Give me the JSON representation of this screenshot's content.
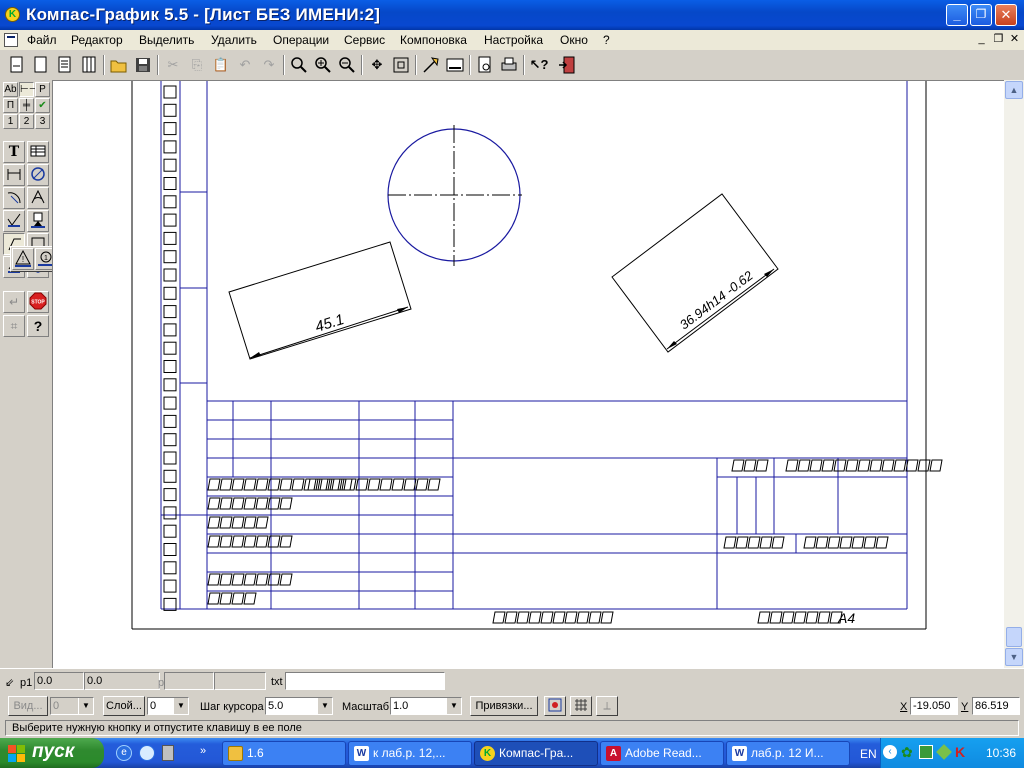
{
  "window": {
    "title": "Компас-График 5.5 - [Лист БЕЗ ИМЕНИ:2]",
    "minimize": "_",
    "maximize": "❐",
    "close": "✕"
  },
  "menu": {
    "items": [
      "Файл",
      "Редактор",
      "Выделить",
      "Удалить",
      "Операции",
      "Сервис",
      "Компоновка",
      "Настройка",
      "Окно",
      "?"
    ]
  },
  "left_panel": {
    "tabs_row1": [
      "Ab",
      "⊢⊣",
      "P"
    ],
    "tabs_row2": [
      "П",
      "╪",
      "✔"
    ],
    "tabs_row3": [
      "1",
      "2",
      "3"
    ]
  },
  "drawing": {
    "dimension_1": "45.1",
    "dimension_2": "36.94h14 -0.62",
    "format_label": "А4"
  },
  "coord_bar": {
    "p1_label": "р1",
    "p1_x": "0.0",
    "p1_y": "0.0",
    "p_label": "р",
    "txt_label": "txt",
    "txt_value": ""
  },
  "params_bar": {
    "view_button": "Вид...",
    "view_value": "0",
    "layer_button": "Слой...",
    "layer_value": "0",
    "cursor_step_label": "Шаг курсора",
    "cursor_step_value": "5.0",
    "scale_label": "Масштаб",
    "scale_value": "1.0",
    "snaps_button": "Привязки...",
    "x_label": "X",
    "x_value": "-19.050",
    "y_label": "Y",
    "y_value": "86.519"
  },
  "status": {
    "text": "Выберите нужную кнопку и отпустите клавишу в ее поле"
  },
  "taskbar": {
    "start": "пуск",
    "tasks": [
      {
        "label": "1.6"
      },
      {
        "label": "к лаб.р. 12,..."
      },
      {
        "label": "Компас-Гра..."
      },
      {
        "label": "Adobe Read..."
      },
      {
        "label": "лаб.р. 12 И..."
      }
    ],
    "lang": "EN",
    "clock": "10:36"
  }
}
